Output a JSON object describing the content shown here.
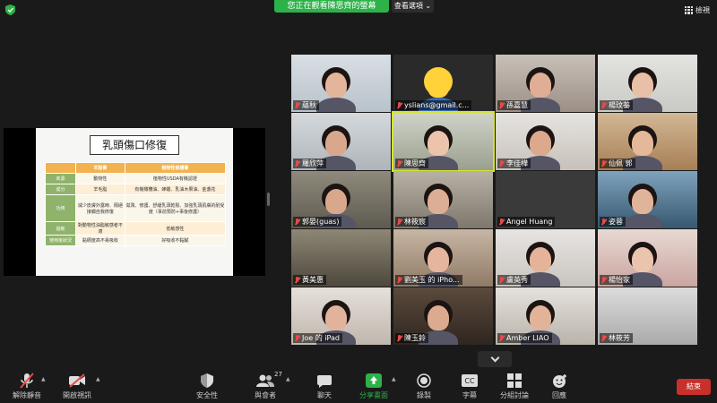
{
  "header": {
    "viewing_banner": "您正在觀看陳思齊的螢幕",
    "view_options": "查看選項 ⌄",
    "view_label": "檢視",
    "accent_green": "#2db24a"
  },
  "slide": {
    "title": "乳頭傷口修復",
    "columns": [
      "",
      "羊脂膏",
      "植物性修護膏"
    ],
    "rows": [
      {
        "label": "來源",
        "a": "動物性",
        "b": "植物性USDA有機認證"
      },
      {
        "label": "成分",
        "a": "羊毛脂",
        "b": "有機橄欖油、蜂蠟、乳油木果油、金盞花"
      },
      {
        "label": "功用",
        "a": "減少皮膚外露時、隔絕接觸自我修復",
        "b": "滋潤、修護、舒緩乳頭乾裂、加強乳頭肌膚的耐受度（事前預防+事後修護）"
      },
      {
        "label": "過敏",
        "a": "對動物性油脂敏感者不適",
        "b": "低敏感性"
      },
      {
        "label": "使用後狀況",
        "a": "黏稠度高不易吸收",
        "b": "好吸收不黏膩"
      }
    ]
  },
  "participants": [
    {
      "name": "蘊秋"
    },
    {
      "name": "yslians@gmail.c..."
    },
    {
      "name": "孫嘉慧"
    },
    {
      "name": "楊玟蓁"
    },
    {
      "name": "羅欣萍"
    },
    {
      "name": "陳思齊"
    },
    {
      "name": "李佳樺"
    },
    {
      "name": "仙佩 郭"
    },
    {
      "name": "郭晏(guas)"
    },
    {
      "name": "林筱宸"
    },
    {
      "name": "Angel Huang"
    },
    {
      "name": "姿蓉"
    },
    {
      "name": "黃美惠"
    },
    {
      "name": "劉美玉 的 iPho..."
    },
    {
      "name": "盧英秀"
    },
    {
      "name": "楊怡家"
    },
    {
      "name": "Joe 的 iPad"
    },
    {
      "name": "陳玉鈴"
    },
    {
      "name": "Amber LIAO"
    },
    {
      "name": "林筱芳"
    }
  ],
  "toolbar": {
    "unmute": "解除靜音",
    "start_video": "開啟視訊",
    "security": "安全性",
    "participants": "與會者",
    "participants_count": "27",
    "chat": "聊天",
    "share_screen": "分享畫面",
    "record": "錄製",
    "captions": "字幕",
    "breakout": "分組討論",
    "reactions": "回應",
    "end": "結束"
  }
}
